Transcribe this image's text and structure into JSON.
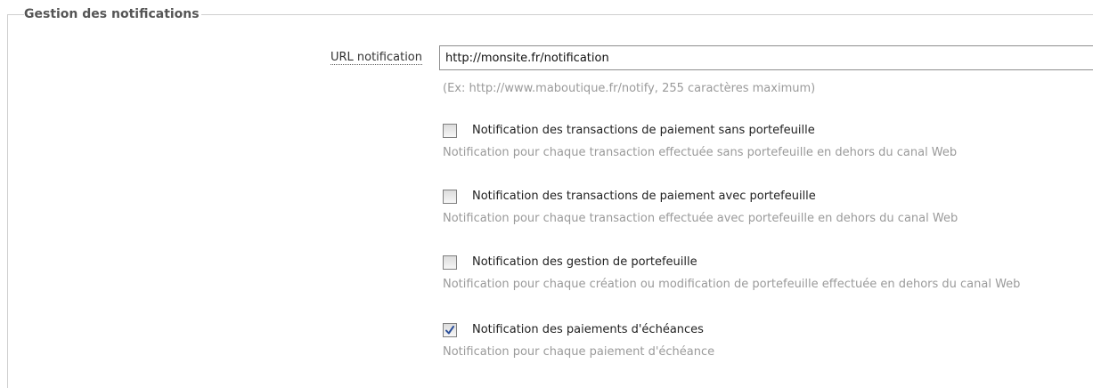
{
  "fieldset": {
    "legend": "Gestion des notifications"
  },
  "url": {
    "label": "URL notification",
    "value": "http://monsite.fr/notification",
    "hint": "(Ex: http://www.maboutique.fr/notify, 255 caractères maximum)"
  },
  "options": [
    {
      "label": "Notification des transactions de paiement sans portefeuille",
      "description": "Notification pour chaque transaction effectuée sans portefeuille en dehors du canal Web",
      "checked": false
    },
    {
      "label": "Notification des transactions de paiement avec portefeuille",
      "description": "Notification pour chaque transaction effectuée avec portefeuille en dehors du canal Web",
      "checked": false
    },
    {
      "label": "Notification des gestion de portefeuille",
      "description": "Notification pour chaque création ou modification de portefeuille effectuée en dehors du canal Web",
      "checked": false
    },
    {
      "label": "Notification des paiements d'échéances",
      "description": "Notification pour chaque paiement d'échéance",
      "checked": true
    }
  ],
  "icons": {
    "checkmark": "checkmark-icon"
  },
  "colors": {
    "checkmark": "#2b4f9a",
    "hint_text": "#9a9a9a"
  }
}
